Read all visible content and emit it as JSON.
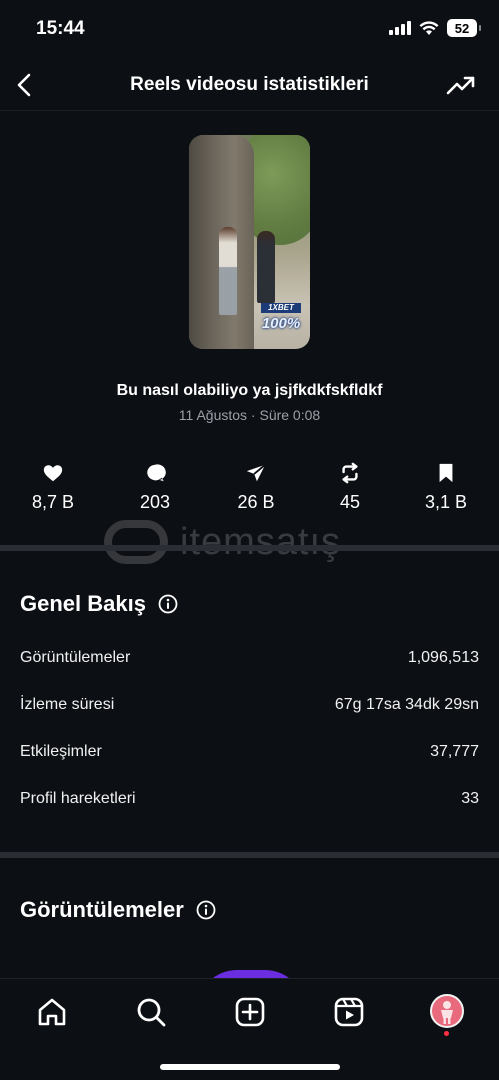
{
  "status_bar": {
    "time": "15:44",
    "battery": "52"
  },
  "header": {
    "title": "Reels videosu istatistikleri"
  },
  "video": {
    "caption": "Bu nasıl olabiliyo ya jsjfkdkfskfldkf",
    "meta": "11 Ağustos · Süre 0:08",
    "thumbnail_brand": "1XBET",
    "thumbnail_percent": "100%"
  },
  "engagement": {
    "likes": "8,7 B",
    "comments": "203",
    "shares": "26 B",
    "reposts": "45",
    "saves": "3,1 B"
  },
  "watermark": {
    "text": "itemsatış"
  },
  "overview": {
    "title": "Genel Bakış",
    "rows": [
      {
        "label": "Görüntülemeler",
        "value": "1,096,513"
      },
      {
        "label": "İzleme süresi",
        "value": "67g 17sa 34dk 29sn"
      },
      {
        "label": "Etkileşimler",
        "value": "37,777"
      },
      {
        "label": "Profil hareketleri",
        "value": "33"
      }
    ]
  },
  "views_section": {
    "title": "Görüntülemeler"
  },
  "colors": {
    "background": "#0c0f14",
    "accent_chart": "#6a2de0",
    "notification_dot": "#ff3040"
  },
  "icons": {
    "back": "back-arrow-icon",
    "trend": "trending-up-icon",
    "like": "heart-icon",
    "comment": "comment-bubble-icon",
    "share": "send-icon",
    "repost": "repost-icon",
    "save": "bookmark-icon",
    "info": "info-icon",
    "tabs": [
      "home-icon",
      "search-icon",
      "create-icon",
      "reels-icon",
      "profile-avatar"
    ]
  }
}
